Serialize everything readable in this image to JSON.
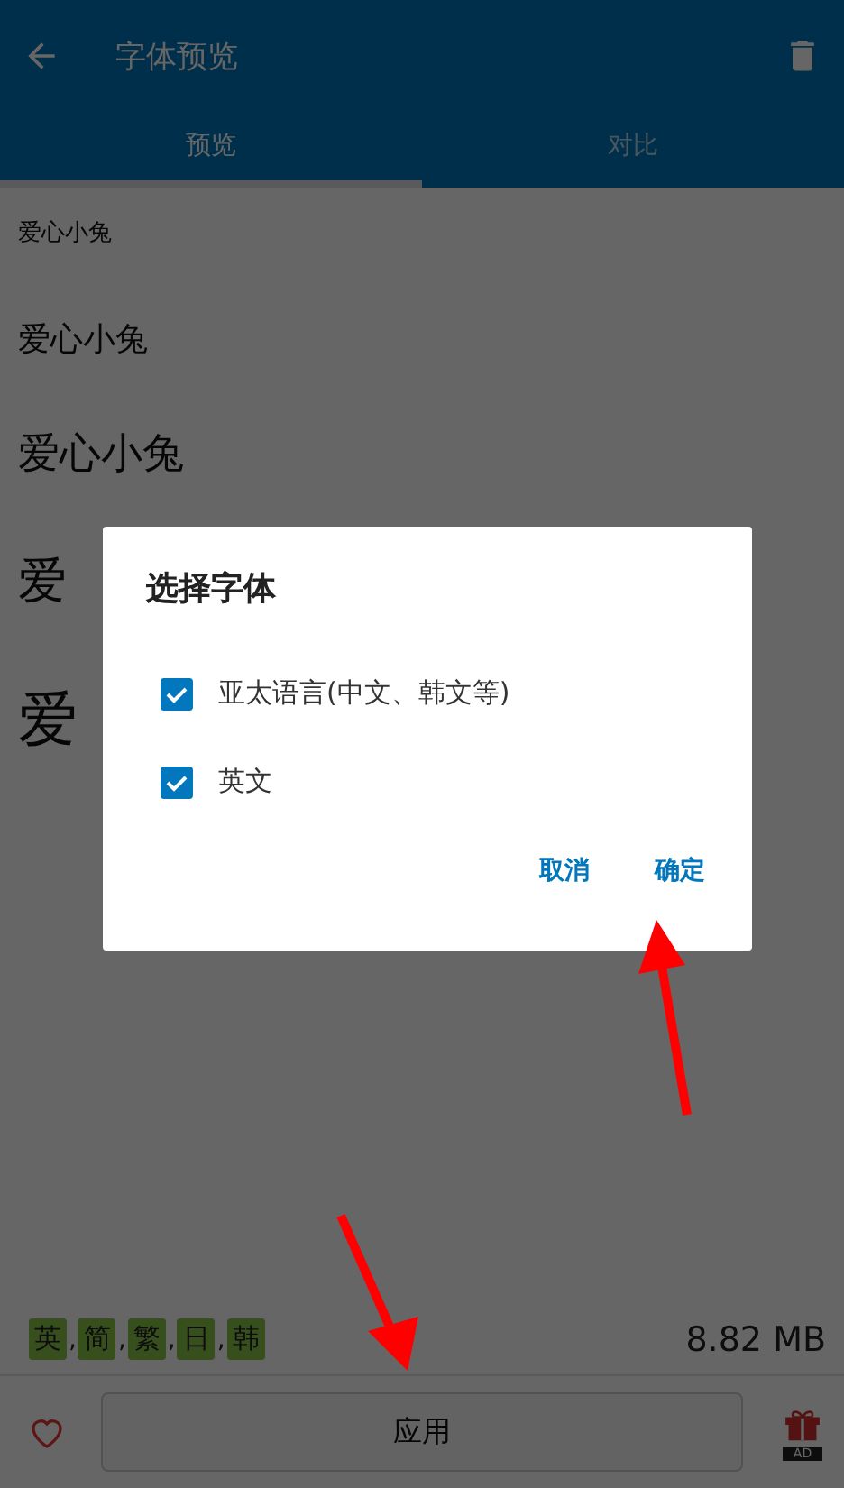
{
  "header": {
    "title": "字体预览"
  },
  "tabs": [
    {
      "label": "预览",
      "selected": true
    },
    {
      "label": "对比",
      "selected": false
    }
  ],
  "preview_samples": [
    "爱心小兔",
    "爱心小兔",
    "爱心小兔",
    "爱",
    "爱"
  ],
  "languages": {
    "tags": [
      "英",
      "简",
      "繁",
      "日",
      "韩"
    ],
    "separator": ","
  },
  "file_size": "8.82 MB",
  "bottom_bar": {
    "favorite": false,
    "apply_button": "应用",
    "gift_badge": "AD"
  },
  "dialog": {
    "title": "选择字体",
    "options": [
      {
        "label": "亚太语言(中文、韩文等)",
        "checked": true
      },
      {
        "label": "英文",
        "checked": true
      }
    ],
    "buttons": [
      "取消",
      "确定"
    ]
  }
}
